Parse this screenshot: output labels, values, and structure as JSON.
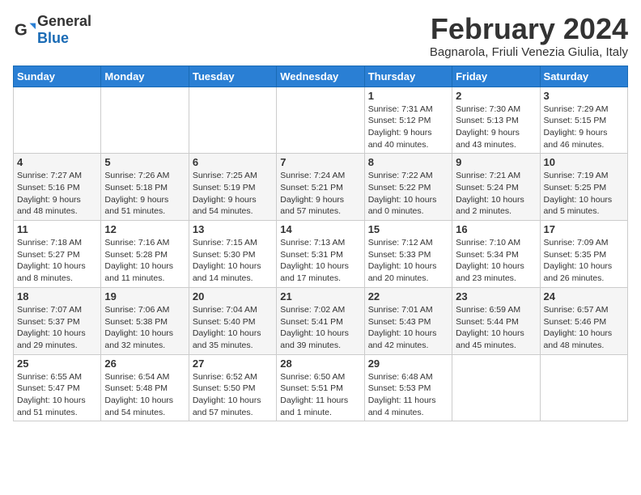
{
  "logo": {
    "text_general": "General",
    "text_blue": "Blue"
  },
  "title": "February 2024",
  "subtitle": "Bagnarola, Friuli Venezia Giulia, Italy",
  "days_of_week": [
    "Sunday",
    "Monday",
    "Tuesday",
    "Wednesday",
    "Thursday",
    "Friday",
    "Saturday"
  ],
  "weeks": [
    [
      {
        "day": "",
        "info": ""
      },
      {
        "day": "",
        "info": ""
      },
      {
        "day": "",
        "info": ""
      },
      {
        "day": "",
        "info": ""
      },
      {
        "day": "1",
        "info": "Sunrise: 7:31 AM\nSunset: 5:12 PM\nDaylight: 9 hours\nand 40 minutes."
      },
      {
        "day": "2",
        "info": "Sunrise: 7:30 AM\nSunset: 5:13 PM\nDaylight: 9 hours\nand 43 minutes."
      },
      {
        "day": "3",
        "info": "Sunrise: 7:29 AM\nSunset: 5:15 PM\nDaylight: 9 hours\nand 46 minutes."
      }
    ],
    [
      {
        "day": "4",
        "info": "Sunrise: 7:27 AM\nSunset: 5:16 PM\nDaylight: 9 hours\nand 48 minutes."
      },
      {
        "day": "5",
        "info": "Sunrise: 7:26 AM\nSunset: 5:18 PM\nDaylight: 9 hours\nand 51 minutes."
      },
      {
        "day": "6",
        "info": "Sunrise: 7:25 AM\nSunset: 5:19 PM\nDaylight: 9 hours\nand 54 minutes."
      },
      {
        "day": "7",
        "info": "Sunrise: 7:24 AM\nSunset: 5:21 PM\nDaylight: 9 hours\nand 57 minutes."
      },
      {
        "day": "8",
        "info": "Sunrise: 7:22 AM\nSunset: 5:22 PM\nDaylight: 10 hours\nand 0 minutes."
      },
      {
        "day": "9",
        "info": "Sunrise: 7:21 AM\nSunset: 5:24 PM\nDaylight: 10 hours\nand 2 minutes."
      },
      {
        "day": "10",
        "info": "Sunrise: 7:19 AM\nSunset: 5:25 PM\nDaylight: 10 hours\nand 5 minutes."
      }
    ],
    [
      {
        "day": "11",
        "info": "Sunrise: 7:18 AM\nSunset: 5:27 PM\nDaylight: 10 hours\nand 8 minutes."
      },
      {
        "day": "12",
        "info": "Sunrise: 7:16 AM\nSunset: 5:28 PM\nDaylight: 10 hours\nand 11 minutes."
      },
      {
        "day": "13",
        "info": "Sunrise: 7:15 AM\nSunset: 5:30 PM\nDaylight: 10 hours\nand 14 minutes."
      },
      {
        "day": "14",
        "info": "Sunrise: 7:13 AM\nSunset: 5:31 PM\nDaylight: 10 hours\nand 17 minutes."
      },
      {
        "day": "15",
        "info": "Sunrise: 7:12 AM\nSunset: 5:33 PM\nDaylight: 10 hours\nand 20 minutes."
      },
      {
        "day": "16",
        "info": "Sunrise: 7:10 AM\nSunset: 5:34 PM\nDaylight: 10 hours\nand 23 minutes."
      },
      {
        "day": "17",
        "info": "Sunrise: 7:09 AM\nSunset: 5:35 PM\nDaylight: 10 hours\nand 26 minutes."
      }
    ],
    [
      {
        "day": "18",
        "info": "Sunrise: 7:07 AM\nSunset: 5:37 PM\nDaylight: 10 hours\nand 29 minutes."
      },
      {
        "day": "19",
        "info": "Sunrise: 7:06 AM\nSunset: 5:38 PM\nDaylight: 10 hours\nand 32 minutes."
      },
      {
        "day": "20",
        "info": "Sunrise: 7:04 AM\nSunset: 5:40 PM\nDaylight: 10 hours\nand 35 minutes."
      },
      {
        "day": "21",
        "info": "Sunrise: 7:02 AM\nSunset: 5:41 PM\nDaylight: 10 hours\nand 39 minutes."
      },
      {
        "day": "22",
        "info": "Sunrise: 7:01 AM\nSunset: 5:43 PM\nDaylight: 10 hours\nand 42 minutes."
      },
      {
        "day": "23",
        "info": "Sunrise: 6:59 AM\nSunset: 5:44 PM\nDaylight: 10 hours\nand 45 minutes."
      },
      {
        "day": "24",
        "info": "Sunrise: 6:57 AM\nSunset: 5:46 PM\nDaylight: 10 hours\nand 48 minutes."
      }
    ],
    [
      {
        "day": "25",
        "info": "Sunrise: 6:55 AM\nSunset: 5:47 PM\nDaylight: 10 hours\nand 51 minutes."
      },
      {
        "day": "26",
        "info": "Sunrise: 6:54 AM\nSunset: 5:48 PM\nDaylight: 10 hours\nand 54 minutes."
      },
      {
        "day": "27",
        "info": "Sunrise: 6:52 AM\nSunset: 5:50 PM\nDaylight: 10 hours\nand 57 minutes."
      },
      {
        "day": "28",
        "info": "Sunrise: 6:50 AM\nSunset: 5:51 PM\nDaylight: 11 hours\nand 1 minute."
      },
      {
        "day": "29",
        "info": "Sunrise: 6:48 AM\nSunset: 5:53 PM\nDaylight: 11 hours\nand 4 minutes."
      },
      {
        "day": "",
        "info": ""
      },
      {
        "day": "",
        "info": ""
      }
    ]
  ]
}
